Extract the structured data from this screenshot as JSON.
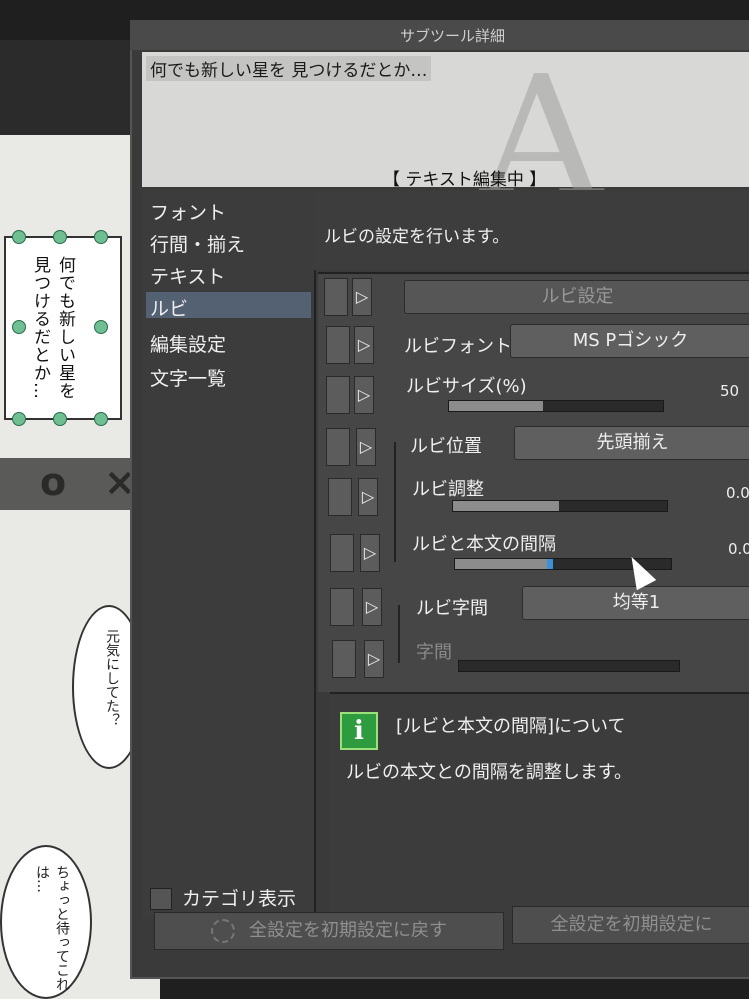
{
  "window": {
    "title": "サブツール詳細"
  },
  "preview": {
    "sample_text": "何でも新しい星を 見つけるだとか…",
    "glyph": "A",
    "status": "【 テキスト編集中 】"
  },
  "categories": {
    "items": [
      {
        "label": "フォント"
      },
      {
        "label": "行間・揃え"
      },
      {
        "label": "テキスト"
      },
      {
        "label": "ルビ"
      },
      {
        "label": "編集設定"
      },
      {
        "label": "文字一覧"
      }
    ],
    "selected": "ルビ",
    "show_category_label": "カテゴリ表示"
  },
  "description": "ルビの設定を行います。",
  "properties": {
    "ruby_setting_button": "ルビ設定",
    "ruby_font_label": "ルビフォント",
    "ruby_font_value": "MS Pゴシック",
    "ruby_size_label": "ルビサイズ(%)",
    "ruby_size_value": "50",
    "ruby_position_label": "ルビ位置",
    "ruby_position_value": "先頭揃え",
    "ruby_adjust_label": "ルビ調整",
    "ruby_adjust_value": "0.0",
    "ruby_gap_label": "ルビと本文の間隔",
    "ruby_gap_value": "0.0",
    "ruby_spacing_label": "ルビ字間",
    "ruby_spacing_value": "均等1",
    "char_spacing_label": "字間",
    "expand_arrow": "▷"
  },
  "help": {
    "icon": "i",
    "title": "[ルビと本文の間隔]について",
    "body": "ルビの本文との間隔を調整します。"
  },
  "footer": {
    "reset_all_label": "全設定を初期設定に戻す",
    "save_all_label": "全設定を初期設定に"
  },
  "canvas": {
    "vertical_text": "何でも新しい星を見つけるだとか…",
    "bubble1": "元気にしてた？",
    "bubble2": "ちょっと待ってこれは…"
  },
  "colors": {
    "panel": "#3a3a3a",
    "selection": "#546172",
    "info_green": "#2f9b3f"
  }
}
